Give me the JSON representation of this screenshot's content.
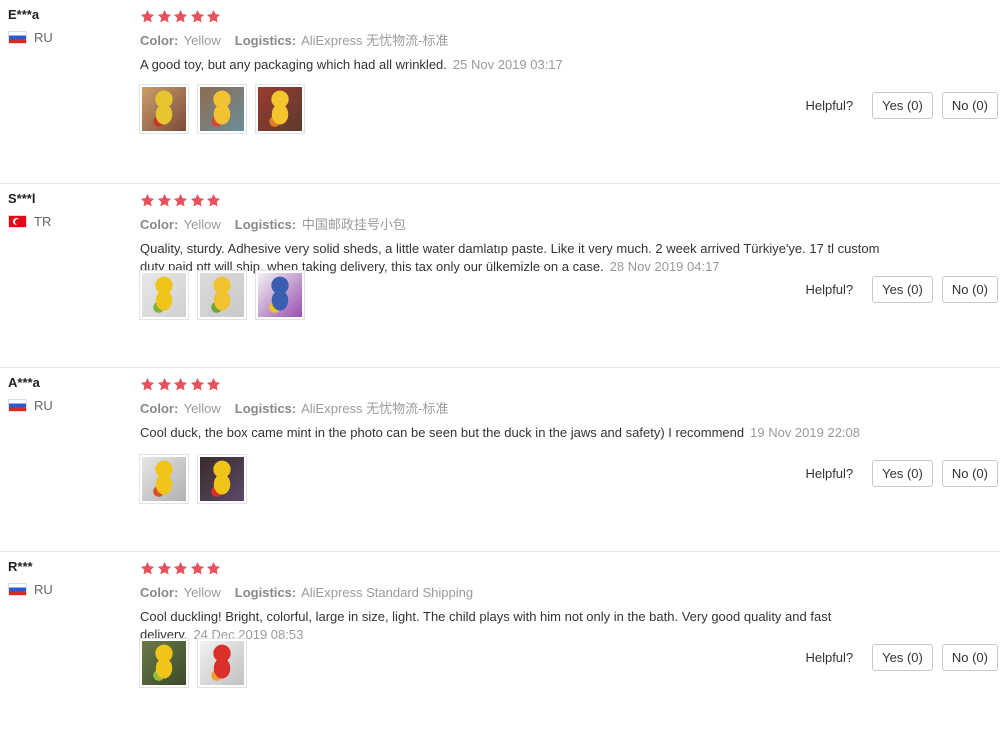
{
  "colors": {
    "star": "#e8505b",
    "meta_value": "#9a9a9a"
  },
  "labels": {
    "color": "Color:",
    "logistics": "Logistics:",
    "helpful": "Helpful?"
  },
  "reviews": [
    {
      "user": "E***a",
      "country_code": "RU",
      "country": "RU",
      "rating": 5,
      "color": "Yellow",
      "logistics": "AliExpress 无忧物流-标准",
      "text": "A good toy, but any packaging which had all wrinkled.",
      "date": "25 Nov 2019 03:17",
      "photos": [
        "photo-packaged-duck-1",
        "photo-packaged-duck-2",
        "photo-packaged-duck-3"
      ],
      "yes": "Yes (0)",
      "no": "No (0)"
    },
    {
      "user": "S***l",
      "country_code": "TR",
      "country": "TR",
      "rating": 5,
      "color": "Yellow",
      "logistics": "中国邮政挂号小包",
      "text": "Quality, sturdy. Adhesive very solid sheds, a little water damlatıp paste. Like it very much. 2 week arrived Türkiye'ye. 17 tl custom duty paid ptt will ship, when taking delivery, this tax only our ülkemizle on a case.",
      "date": "28 Nov 2019 04:17",
      "photos": [
        "photo-duck-on-table",
        "photo-duck-side",
        "photo-duck-box"
      ],
      "yes": "Yes (0)",
      "no": "No (0)"
    },
    {
      "user": "A***a",
      "country_code": "RU",
      "country": "RU",
      "rating": 5,
      "color": "Yellow",
      "logistics": "AliExpress 无忧物流-标准",
      "text": "Cool duck, the box came mint in the photo can be seen but the duck in the jaws and safety) I recommend",
      "date": "19 Nov 2019 22:08",
      "photos": [
        "photo-duck-front",
        "photo-duck-in-hand"
      ],
      "yes": "Yes (0)",
      "no": "No (0)"
    },
    {
      "user": "R***",
      "country_code": "RU",
      "country": "RU",
      "rating": 5,
      "color": "Yellow",
      "logistics": "AliExpress Standard Shipping",
      "text": "Cool duckling! Bright, colorful, large in size, light. The child plays with him not only in the bath. Very good quality and fast delivery.",
      "date": "24 Dec 2019 08:53",
      "photos": [
        "photo-duck-green-bg",
        "photo-duck-red"
      ],
      "yes": "Yes (0)",
      "no": "No (0)"
    }
  ]
}
